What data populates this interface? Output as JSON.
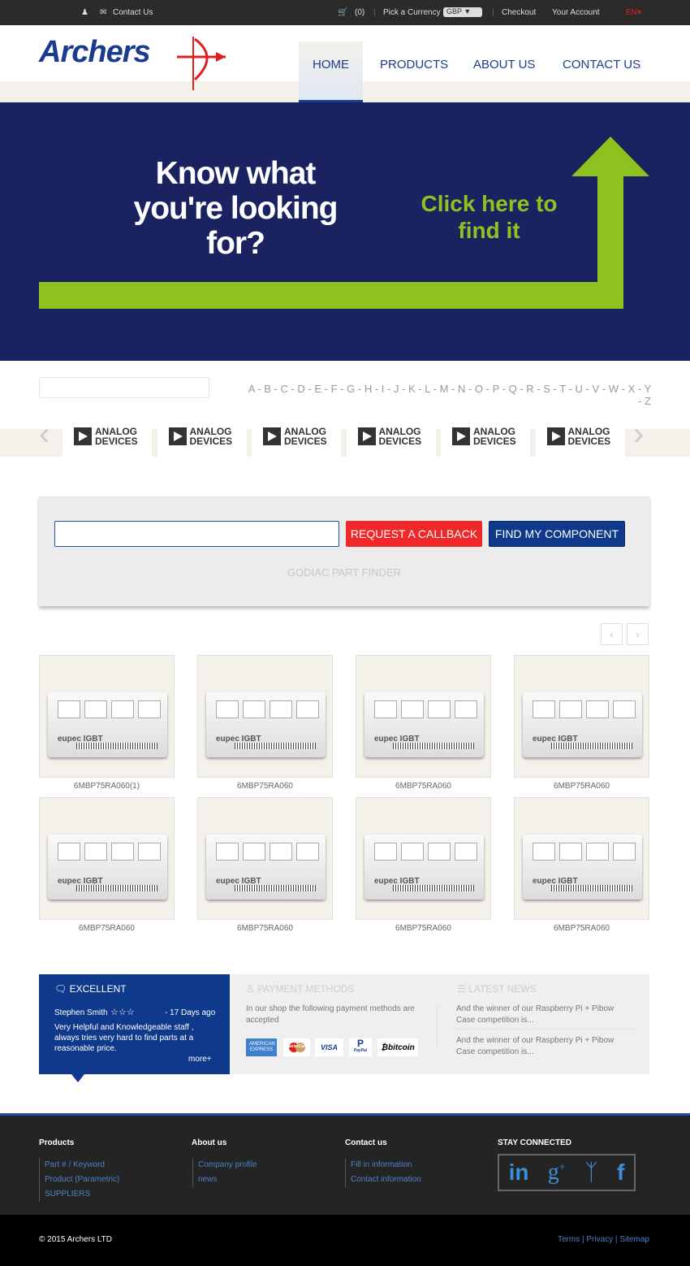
{
  "topbar": {
    "contact": "Contact Us",
    "cart_count": "(0)",
    "currency_label": "Pick a Currency",
    "currency": "GBP",
    "checkout": "Checkout",
    "account": "Your Account",
    "lang": "EN"
  },
  "header": {
    "logo": "Archers",
    "nav": [
      "HOME",
      "PRODUCTS",
      "ABOUT US",
      "CONTACT US"
    ],
    "active": "HOME"
  },
  "hero": {
    "question": "Know what you're looking for?",
    "cta": "Click here to find it",
    "colors": {
      "bg": "#1a2360",
      "accent": "#8dc21f"
    }
  },
  "alphabet": [
    "A",
    "B",
    "C",
    "D",
    "E",
    "F",
    "G",
    "H",
    "I",
    "J",
    "K",
    "L",
    "M",
    "N",
    "O",
    "P",
    "Q",
    "R",
    "S",
    "T",
    "U",
    "V",
    "W",
    "X",
    "Y",
    "Z"
  ],
  "brands": [
    {
      "name": "ANALOG DEVICES"
    },
    {
      "name": "ANALOG DEVICES"
    },
    {
      "name": "ANALOG DEVICES"
    },
    {
      "name": "ANALOG DEVICES"
    },
    {
      "name": "ANALOG DEVICES"
    },
    {
      "name": "ANALOG DEVICES"
    }
  ],
  "finder": {
    "callback": "REQUEST A CALLBACK",
    "find": "FIND MY COMPONENT",
    "title": "GODIAC PART FINDER",
    "input_value": ""
  },
  "products": [
    {
      "name": "6MBP75RA060(1)"
    },
    {
      "name": "6MBP75RA060"
    },
    {
      "name": "6MBP75RA060"
    },
    {
      "name": "6MBP75RA060"
    },
    {
      "name": "6MBP75RA060"
    },
    {
      "name": "6MBP75RA060"
    },
    {
      "name": "6MBP75RA060"
    },
    {
      "name": "6MBP75RA060"
    }
  ],
  "product_brand": "eupec IGBT",
  "review": {
    "title": "EXCELLENT",
    "author": "Stephen Smith",
    "stars": 0,
    "max_stars": 3,
    "age": "- 17 Days ago",
    "text": "Very Helpful and Knowledgeable staff , always tries very hard to find parts at a reasonable price.",
    "more": "more+"
  },
  "payment": {
    "title": "PAYMENT METHODS",
    "text": "In our shop the following payment methods are accepted",
    "methods": [
      "AMERICAN EXPRESS",
      "MasterCard",
      "VISA",
      "PayPal",
      "bitcoin"
    ]
  },
  "news": {
    "title": "LATEST NEWS",
    "items": [
      "And the winner of our Raspberry Pi + Pibow Case competition is...",
      "And the winner of our Raspberry Pi + Pibow Case competition is..."
    ]
  },
  "footer": {
    "products": {
      "title": "Products",
      "links": [
        "Part # / Keyword",
        "Product (Parametric)",
        "SUPPLIERS"
      ]
    },
    "about": {
      "title": "About us",
      "links": [
        "Company profile",
        "news"
      ]
    },
    "contact": {
      "title": "Contact us",
      "links": [
        "Fill in information",
        "Contact information"
      ]
    },
    "social": {
      "title": "STAY CONNECTED",
      "icons": [
        "linkedin",
        "google-plus",
        "twitter",
        "facebook"
      ]
    },
    "copyright": "© 2015 Archers LTD",
    "legal": [
      "Terms",
      "Privacy",
      "Sitemap"
    ]
  }
}
